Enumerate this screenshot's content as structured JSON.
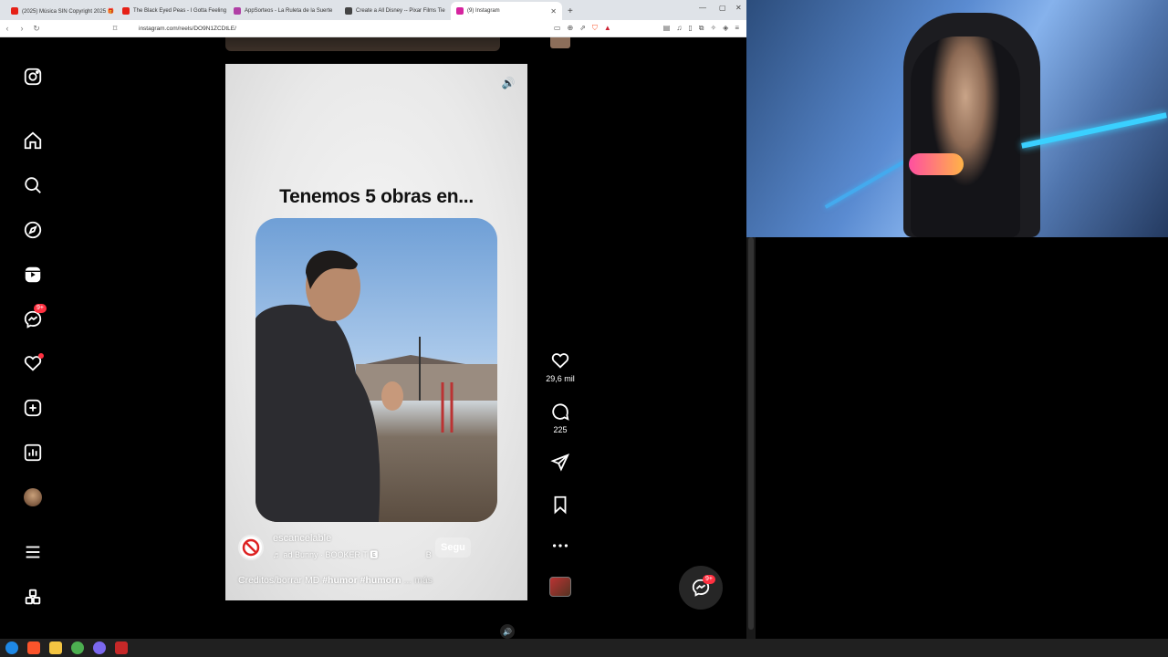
{
  "browser": {
    "tabs": [
      {
        "title": "(2025) Música SIN Copyright 2025 🎁",
        "color": "#e62117"
      },
      {
        "title": "The Black Eyed Peas - I Gotta Feeling",
        "color": "#e62117"
      },
      {
        "title": "AppSorteos - La Ruleta de la Suerte",
        "color": "#b03fa5"
      },
      {
        "title": "Create a All Disney -- Pixar Films Tie",
        "color": "#444444"
      },
      {
        "title": "(9) Instagram",
        "color": "#d6249f"
      }
    ],
    "new_tab": "+",
    "url": "instagram.com/reels/DO9N1ZCDtLE/"
  },
  "sidebar": {
    "messages_badge": "9+"
  },
  "reel": {
    "headline": "Tenemos 5 obras en...",
    "username": "escancelable",
    "audio": "♬ ad Bunny · BOOKER T 🅴",
    "audio_extra": "B",
    "follow": "Segu",
    "caption_text": "Creditos/borrar MD ",
    "caption_tags": "#humor #humorn",
    "caption_more": "... más"
  },
  "actions": {
    "likes": "29,6 mil",
    "comments": "225"
  },
  "fab": {
    "badge": "9+"
  },
  "icons": [
    "instagram-icon",
    "home-icon",
    "search-icon",
    "explore-icon",
    "reels-icon",
    "messenger-icon",
    "heart-icon",
    "create-icon",
    "dashboard-icon",
    "menu-icon",
    "apps-icon",
    "sound-icon",
    "like-icon",
    "comment-icon",
    "share-icon",
    "save-icon",
    "more-icon"
  ]
}
